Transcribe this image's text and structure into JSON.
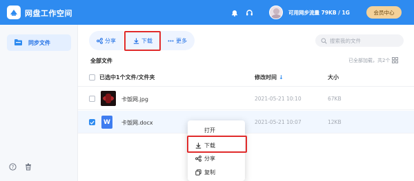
{
  "app": {
    "title": "网盘工作空间"
  },
  "header": {
    "quota_text": "可用网步流量 79KB / 1G",
    "vip_label": "会员中心"
  },
  "sidebar": {
    "items": [
      {
        "label": "同步文件",
        "icon": "folder-icon",
        "active": true
      }
    ],
    "bottom_icons": [
      "help-icon",
      "trash-icon"
    ]
  },
  "toolbar": {
    "share_label": "分享",
    "download_label": "下载",
    "more_label": "更多"
  },
  "search": {
    "placeholder": "搜索我的文件"
  },
  "list": {
    "section_title": "全部文件",
    "loaded_text": "已全部加载，共2个",
    "columns": {
      "name": "已选中1个文件/文件夹",
      "time": "修改时间",
      "size": "大小"
    },
    "rows": [
      {
        "name": "卡饭网.jpg",
        "time": "2021-05-21 10:10",
        "size": "67KB",
        "type": "image",
        "checked": false
      },
      {
        "name": "卡饭网.docx",
        "time": "2021-05-21 10:07",
        "size": "12KB",
        "type": "docx",
        "checked": true
      }
    ]
  },
  "context_menu": {
    "items": [
      {
        "label": "打开",
        "icon": ""
      },
      {
        "label": "下载",
        "icon": "download-icon"
      },
      {
        "label": "分享",
        "icon": "share-icon"
      },
      {
        "label": "复制",
        "icon": "copy-icon"
      }
    ]
  },
  "colors": {
    "accent": "#2e8bf0",
    "highlight_box": "#e02a2a",
    "vip": "#f3d199"
  }
}
